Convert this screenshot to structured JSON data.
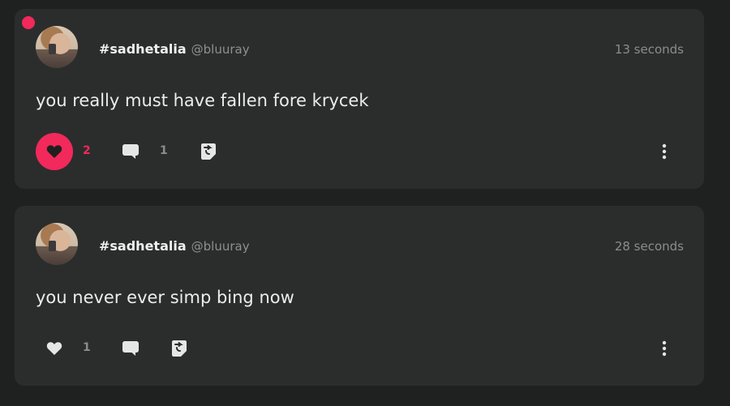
{
  "colors": {
    "accent": "#f2295b",
    "background": "#1f2121",
    "card": "#2b2d2d"
  },
  "posts": [
    {
      "unread": true,
      "tag": "#sadhetalia",
      "handle": "@bluuray",
      "time": "13 seconds",
      "text": "you really must have fallen fore krycek",
      "liked": true,
      "likes": "2",
      "comments": "1"
    },
    {
      "unread": false,
      "tag": "#sadhetalia",
      "handle": "@bluuray",
      "time": "28 seconds",
      "text": "you never ever simp bing now",
      "liked": false,
      "likes": "1",
      "comments": ""
    }
  ],
  "icons": {
    "like": "heart-icon",
    "comment": "speech-bubble-icon",
    "reblog": "reblog-icon",
    "more": "kebab-menu-icon"
  }
}
